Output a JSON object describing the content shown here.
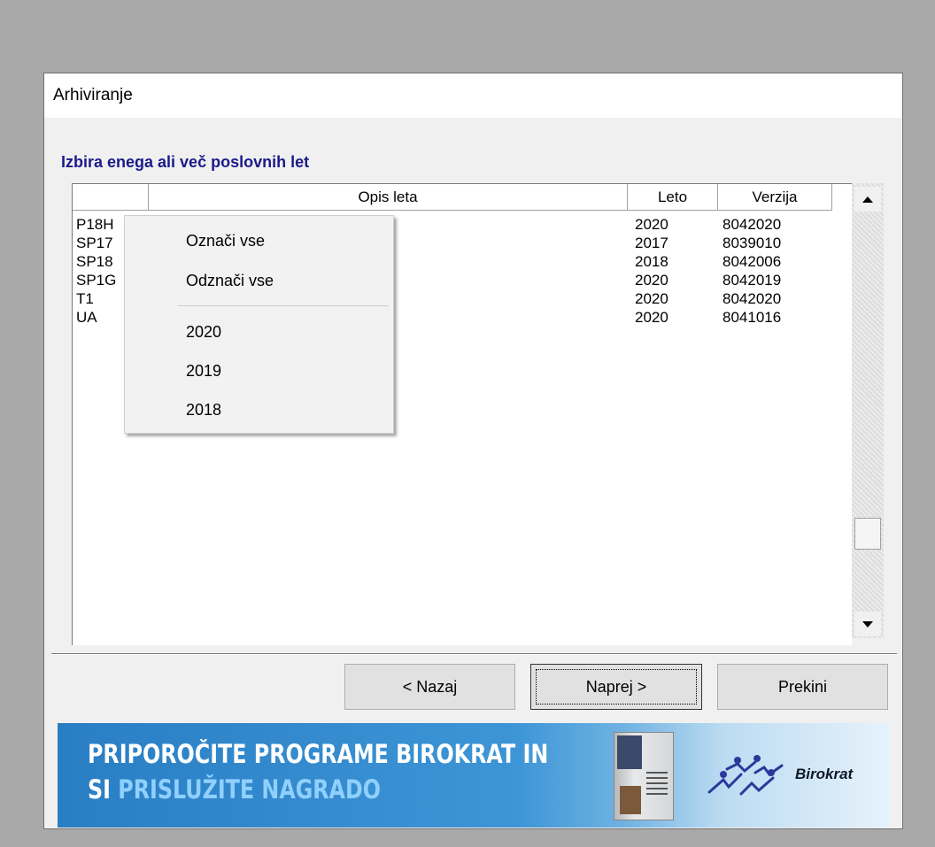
{
  "window": {
    "title": "Arhiviranje"
  },
  "section_heading": "Izbira enega ali več poslovnih let",
  "table": {
    "columns": [
      "",
      "Opis leta",
      "Leto",
      "Verzija"
    ],
    "rows": [
      {
        "code": "P18H",
        "description": "",
        "year": "2020",
        "version": "8042020"
      },
      {
        "code": "SP17",
        "description": "",
        "year": "2017",
        "version": "8039010"
      },
      {
        "code": "SP18",
        "description": "",
        "year": "2018",
        "version": "8042006"
      },
      {
        "code": "SP1G",
        "description": "",
        "year": "2020",
        "version": "8042019"
      },
      {
        "code": "T1",
        "description": "",
        "year": "2020",
        "version": "8042020"
      },
      {
        "code": "UA",
        "description": "",
        "year": "2020",
        "version": "8041016"
      }
    ]
  },
  "context_menu": {
    "items": [
      "Označi vse",
      "Odznači vse",
      "2020",
      "2019",
      "2018"
    ]
  },
  "buttons": {
    "back": "< Nazaj",
    "next": "Naprej >",
    "cancel": "Prekini"
  },
  "banner": {
    "line1": "PRIPOROČITE PROGRAME BIROKRAT IN",
    "line2_prefix": "SI ",
    "line2_highlight": "PRISLUŽITE NAGRADO",
    "brand": "Birokrat"
  },
  "icons": {
    "scroll_up": "triangle-up-icon",
    "scroll_down": "triangle-down-icon"
  }
}
